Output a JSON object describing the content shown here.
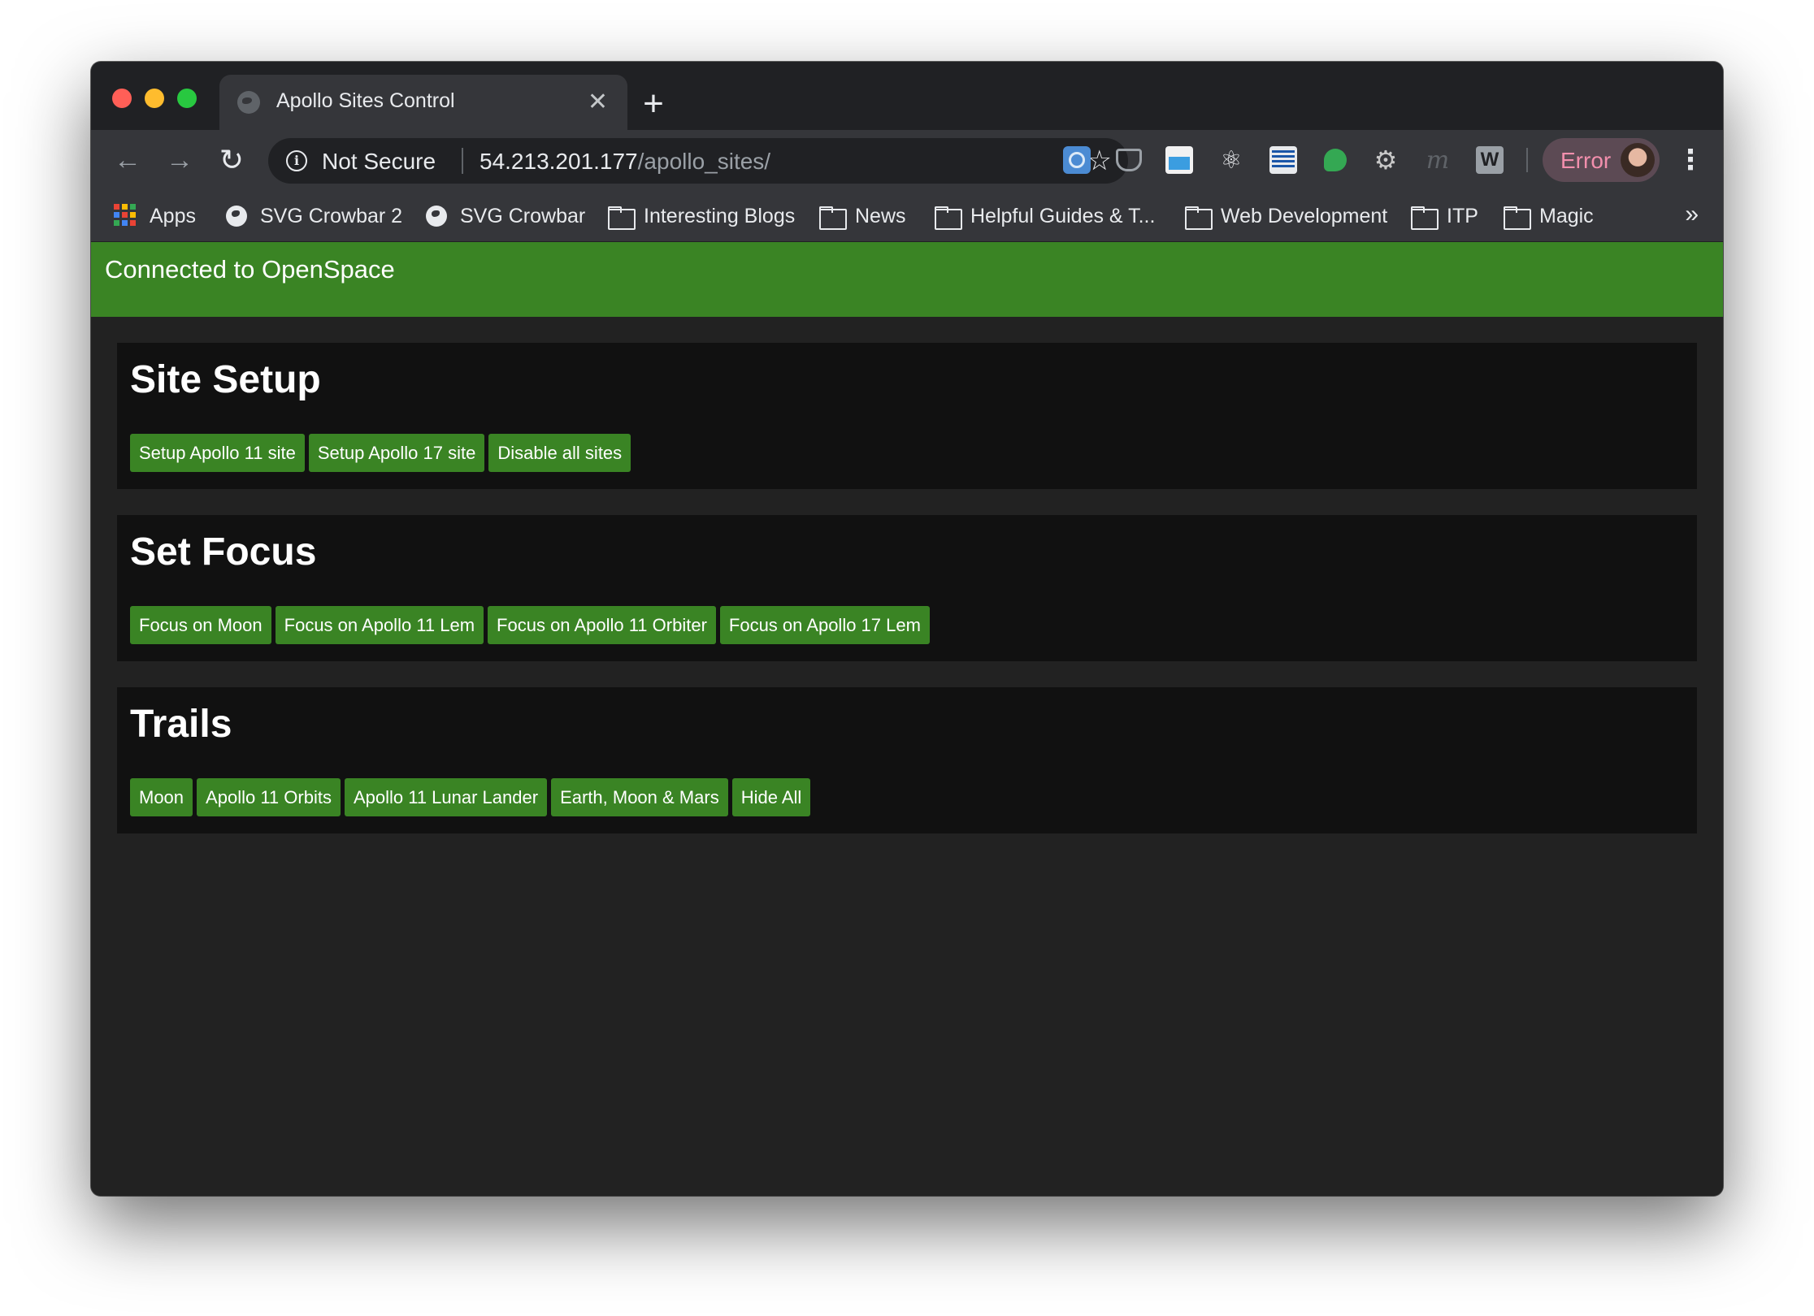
{
  "browser": {
    "tab": {
      "title": "Apollo Sites Control",
      "close_glyph": "✕"
    },
    "new_tab_glyph": "+",
    "nav": {
      "back_glyph": "←",
      "forward_glyph": "→",
      "reload_glyph": "↻"
    },
    "omnibox": {
      "security_label": "Not Secure",
      "url_host": "54.213.201.177",
      "url_path": "/apollo_sites/"
    },
    "profile": {
      "label": "Error"
    },
    "bookmarks": [
      {
        "label": "Apps",
        "icon": "apps-grid-icon"
      },
      {
        "label": "SVG Crowbar 2",
        "icon": "globe-icon"
      },
      {
        "label": "SVG Crowbar",
        "icon": "globe-icon"
      },
      {
        "label": "Interesting Blogs",
        "icon": "folder-icon"
      },
      {
        "label": "News",
        "icon": "folder-icon"
      },
      {
        "label": "Helpful Guides & T...",
        "icon": "folder-icon"
      },
      {
        "label": "Web Development",
        "icon": "folder-icon"
      },
      {
        "label": "ITP",
        "icon": "folder-icon"
      },
      {
        "label": "Magic",
        "icon": "folder-icon"
      }
    ],
    "bookmarks_more_glyph": "»"
  },
  "colors": {
    "accent_green": "#3a8424",
    "panel_bg": "#111111",
    "page_bg": "#222222",
    "profile_text": "#f28fad"
  },
  "status": {
    "text": "Connected to OpenSpace"
  },
  "sections": [
    {
      "title": "Site Setup",
      "buttons": [
        "Setup Apollo 11 site",
        "Setup Apollo 17 site",
        "Disable all sites"
      ]
    },
    {
      "title": "Set Focus",
      "buttons": [
        "Focus on Moon",
        "Focus on Apollo 11 Lem",
        "Focus on Apollo 11 Orbiter",
        "Focus on Apollo 17 Lem"
      ]
    },
    {
      "title": "Trails",
      "buttons": [
        "Moon",
        "Apollo 11 Orbits",
        "Apollo 11 Lunar Lander",
        "Earth, Moon & Mars",
        "Hide All"
      ]
    }
  ]
}
